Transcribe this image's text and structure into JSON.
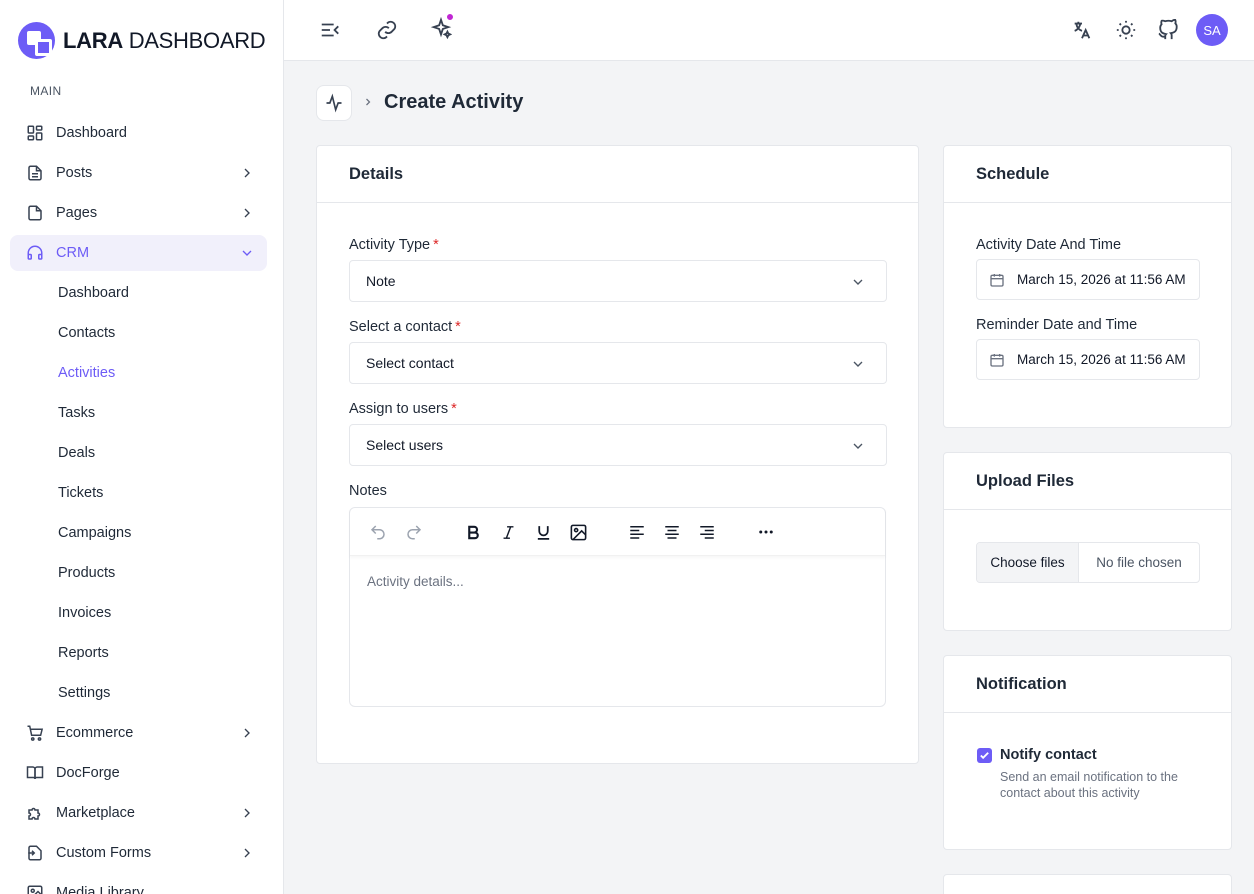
{
  "app": {
    "logo_bold": "LARA",
    "logo_light": " DASHBOARD"
  },
  "sidebar": {
    "section": "MAIN",
    "items": [
      {
        "label": "Dashboard",
        "icon": "dashboard-grid-icon"
      },
      {
        "label": "Posts",
        "icon": "document-icon"
      },
      {
        "label": "Pages",
        "icon": "page-icon"
      },
      {
        "label": "CRM",
        "icon": "headphones-icon"
      }
    ],
    "crm_sub": [
      "Dashboard",
      "Contacts",
      "Activities",
      "Tasks",
      "Deals",
      "Tickets",
      "Campaigns",
      "Products",
      "Invoices",
      "Reports",
      "Settings"
    ],
    "more_items": [
      {
        "label": "Ecommerce",
        "icon": "cart-icon"
      },
      {
        "label": "DocForge",
        "icon": "book-icon"
      },
      {
        "label": "Marketplace",
        "icon": "puzzle-icon"
      },
      {
        "label": "Custom Forms",
        "icon": "form-icon"
      },
      {
        "label": "Media Library",
        "icon": "media-icon"
      }
    ]
  },
  "topbar": {
    "avatar_initials": "SA"
  },
  "page": {
    "title": "Create Activity"
  },
  "details": {
    "heading": "Details",
    "activity_type_label": "Activity Type",
    "activity_type_value": "Note",
    "contact_label": "Select a contact",
    "contact_value": "Select contact",
    "users_label": "Assign to users",
    "users_value": "Select users",
    "notes_label": "Notes",
    "notes_placeholder": "Activity details...",
    "required_mark": "*"
  },
  "schedule": {
    "heading": "Schedule",
    "activity_dt_label": "Activity Date And Time",
    "activity_dt_value": "March 15, 2026 at 11:56 AM",
    "reminder_dt_label": "Reminder Date and Time",
    "reminder_dt_value": "March 15, 2026 at 11:56 AM"
  },
  "upload": {
    "heading": "Upload Files",
    "button": "Choose files",
    "status": "No file chosen"
  },
  "notification": {
    "heading": "Notification",
    "checkbox_label": "Notify contact",
    "checked": true,
    "description": "Send an email notification to the contact about this activity"
  },
  "colors": {
    "accent": "#6d5cf6",
    "required": "#dc2626"
  }
}
